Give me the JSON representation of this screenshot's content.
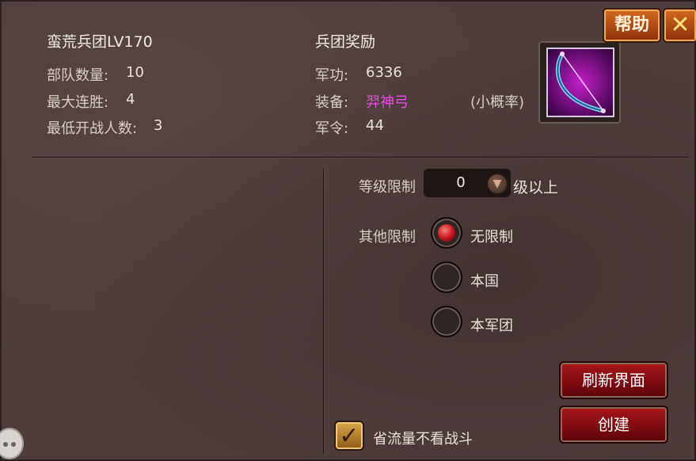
{
  "legion": {
    "name": "蛮荒兵团LV170",
    "stats": [
      {
        "label": "部队数量:",
        "value": "10"
      },
      {
        "label": "最大连胜:",
        "value": "4"
      },
      {
        "label": "最低开战人数:",
        "value": "3"
      }
    ]
  },
  "reward": {
    "title": "兵团奖励",
    "merit_label": "军功:",
    "merit_value": "6336",
    "equip_label": "装备:",
    "equip_value": "羿神弓",
    "equip_chance": "(小概率)",
    "order_label": "军令:",
    "order_value": "44",
    "item_icon": "bow-icon"
  },
  "top_buttons": {
    "help": "帮助",
    "close": "✕"
  },
  "restrictions": {
    "level_label": "等级限制",
    "level_value": "0",
    "level_suffix": "级以上",
    "other_label": "其他限制",
    "options": [
      "无限制",
      "本国",
      "本军团"
    ],
    "selected": "无限制"
  },
  "actions": {
    "refresh": "刷新界面",
    "create": "创建"
  },
  "checkbox": {
    "label": "省流量不看战斗",
    "checked": true
  },
  "colors": {
    "equip": "#e64fe0",
    "panel": "#4e3d3b",
    "button_red": "#a8141c"
  }
}
